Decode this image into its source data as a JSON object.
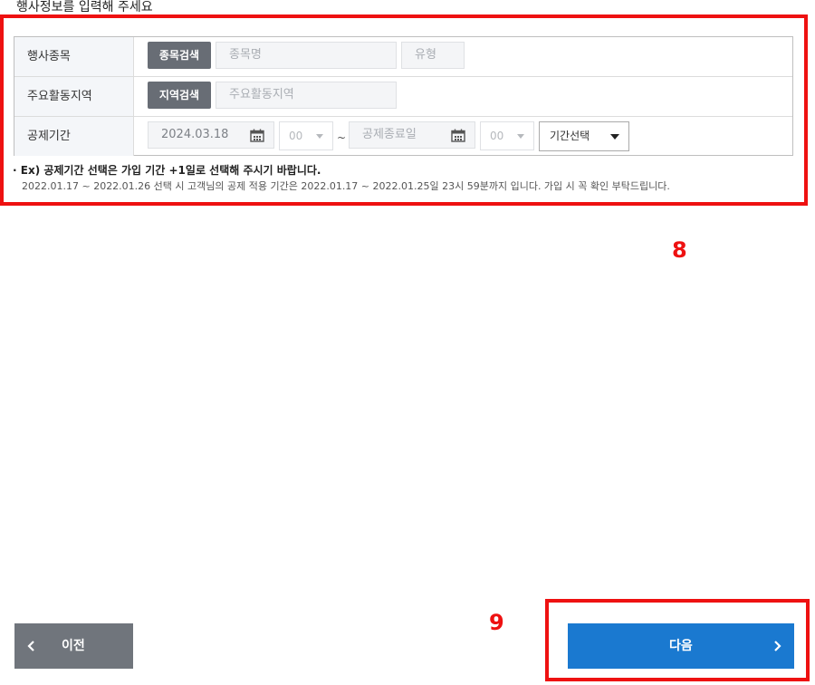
{
  "section_title": "행사정보를 입력해 주세요",
  "annotations": {
    "step8": "8",
    "step9": "9",
    "highlight_color": "#ee1111"
  },
  "form": {
    "rows": [
      {
        "label": "행사종목",
        "search_button": "종목검색",
        "name_placeholder": "종목명",
        "type_placeholder": "유형"
      },
      {
        "label": "주요활동지역",
        "search_button": "지역검색",
        "region_placeholder": "주요활동지역"
      },
      {
        "label": "공제기간",
        "start_date": "2024.03.18",
        "start_hour": "00",
        "separator": "~",
        "end_date_placeholder": "공제종료일",
        "end_hour": "00",
        "period_select": "기간선택"
      }
    ]
  },
  "notes": {
    "bullet": "·",
    "bold": "Ex) 공제기간 선택은 가입 기간 +1일로 선택해 주시기 바랍니다.",
    "detail": "2022.01.17 ~ 2022.01.26 선택 시 고객님의 공제 적용 기간은 2022.01.17 ~ 2022.01.25일 23시 59분까지 입니다. 가입 시 꼭 확인 부탁드립니다."
  },
  "nav": {
    "prev_label": "이전",
    "next_label": "다음",
    "prev_color": "#70757c",
    "next_color": "#1a79d0"
  }
}
